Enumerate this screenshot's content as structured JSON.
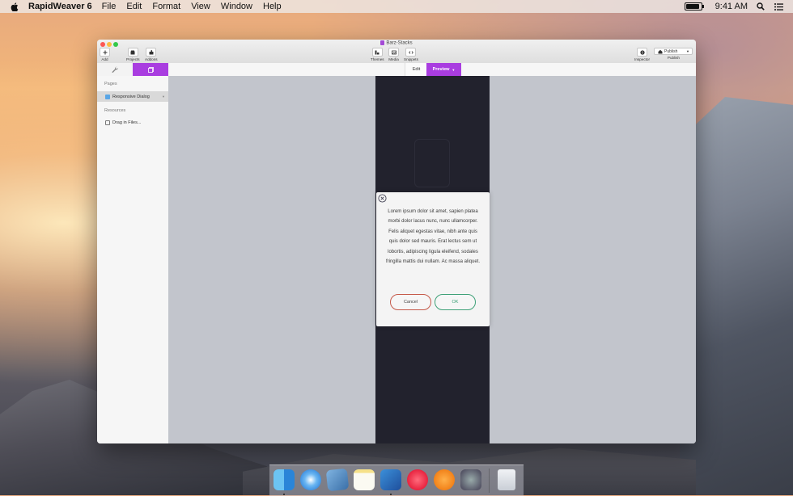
{
  "menubar": {
    "app_name": "RapidWeaver 6",
    "menus": [
      "File",
      "Edit",
      "Format",
      "View",
      "Window",
      "Help"
    ],
    "clock": "9:41 AM",
    "battery_level": 0.9
  },
  "window": {
    "doc_title": "Barz-Stacks",
    "toolbar": {
      "add": "Add",
      "projects": "Projects",
      "addons": "Addons",
      "themes": "Themes",
      "media": "Media",
      "snippets": "Snippets",
      "inspector": "Inspector",
      "publish_button": "Publish",
      "publish_label": "Publish"
    },
    "modebar": {
      "edit": "Edit",
      "preview": "Preview"
    },
    "sidebar": {
      "pages_heading": "Pages",
      "page_item": "Responsive Dialog",
      "resources_heading": "Resources",
      "drag_item": "Drag in Files..."
    }
  },
  "dialog": {
    "body": "Lorem ipsum dolor sit amet, sapien platea morbi dolor lacus nunc, nunc ullamcorper. Felis aliquet egestas vitae, nibh ante quis quis dolor sed mauris. Erat lectus sem ut lobortis, adipiscing ligula eleifend, sodales fringilla mattis dui nullam. Ac massa aliquet.",
    "cancel": "Cancel",
    "ok": "OK"
  },
  "colors": {
    "accent": "#a93de0",
    "cancel_border": "#c55a4a",
    "ok_border": "#3fa178"
  },
  "dock": {
    "icons": [
      "finder-icon",
      "safari-icon",
      "preview-icon",
      "notes-icon",
      "rapidweaver-icon",
      "itunes-icon",
      "ibooks-icon",
      "system-preferences-icon",
      "trash-icon"
    ]
  }
}
